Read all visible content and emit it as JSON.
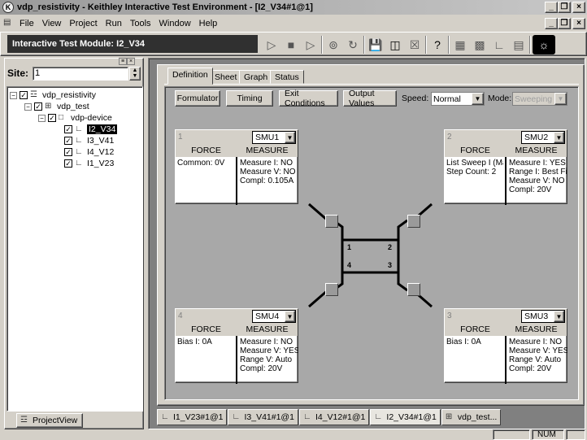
{
  "window": {
    "title": "vdp_resistivity - Keithley Interactive Test Environment - [I2_V34#1@1]",
    "doc_controls": [
      "_",
      "×"
    ],
    "window_controls": [
      "_",
      "❐",
      "×"
    ]
  },
  "menu": [
    "File",
    "View",
    "Project",
    "Run",
    "Tools",
    "Window",
    "Help"
  ],
  "toolbar": {
    "module_title": "Interactive Test Module: I2_V34",
    "icons": [
      "run-icon",
      "stop-icon",
      "run-step-icon",
      "append-run-icon",
      "repeat-icon",
      "save-icon",
      "save-all-icon",
      "close-icon",
      "help-icon",
      "grid-icon",
      "device-icon",
      "itm-icon",
      "sheet-icon",
      "logo-icon"
    ]
  },
  "project_panel": {
    "site_label": "Site:",
    "site_value": "1",
    "tree": [
      {
        "label": "vdp_resistivity",
        "level": 0,
        "icon": "project-icon"
      },
      {
        "label": "vdp_test",
        "level": 1,
        "icon": "plan-icon"
      },
      {
        "label": "vdp-device",
        "level": 2,
        "icon": "device-icon"
      },
      {
        "label": "I2_V34",
        "level": 3,
        "icon": "itm-icon",
        "selected": true
      },
      {
        "label": "I3_V41",
        "level": 3,
        "icon": "itm-icon"
      },
      {
        "label": "I4_V12",
        "level": 3,
        "icon": "itm-icon"
      },
      {
        "label": "I1_V23",
        "level": 3,
        "icon": "itm-icon"
      }
    ],
    "bottom_tab": "ProjectView"
  },
  "tabs": [
    "Definition",
    "Sheet",
    "Graph",
    "Status"
  ],
  "definition": {
    "buttons": [
      "Formulator",
      "Timing",
      "Exit Conditions",
      "Output Values"
    ],
    "speed_label": "Speed:",
    "speed_value": "Normal",
    "mode_label": "Mode:",
    "mode_value": "Sweeping"
  },
  "smus": [
    {
      "number": "1",
      "instrument": "SMU1",
      "force_header": "FORCE",
      "measure_header": "MEASURE",
      "force": [
        "Common: 0V"
      ],
      "measure": [
        "Measure I: NO",
        "Measure V: NO",
        "Compl: 0.105A"
      ]
    },
    {
      "number": "2",
      "instrument": "SMU2",
      "force_header": "FORCE",
      "measure_header": "MEASURE",
      "force": [
        "List Sweep I (Mas",
        "Step Count: 2"
      ],
      "measure": [
        "Measure I: YES",
        "Range I: Best Fix",
        "Measure V: NO",
        "Compl: 20V"
      ]
    },
    {
      "number": "4",
      "instrument": "SMU4",
      "force_header": "FORCE",
      "measure_header": "MEASURE",
      "force": [
        "Bias I: 0A"
      ],
      "measure": [
        "Measure I: NO",
        "Measure V: YES",
        "Range V: Auto",
        "Compl: 20V"
      ]
    },
    {
      "number": "3",
      "instrument": "SMU3",
      "force_header": "FORCE",
      "measure_header": "MEASURE",
      "force": [
        "Bias I: 0A"
      ],
      "measure": [
        "Measure I: NO",
        "Measure V: YES",
        "Range V: Auto",
        "Compl: 20V"
      ]
    }
  ],
  "device_pins": [
    "1",
    "2",
    "4",
    "3"
  ],
  "doc_tabs": [
    {
      "label": "I1_V23#1@1",
      "active": false
    },
    {
      "label": "I3_V41#1@1",
      "active": false
    },
    {
      "label": "I4_V12#1@1",
      "active": false
    },
    {
      "label": "I2_V34#1@1",
      "active": true
    },
    {
      "label": "vdp_test...",
      "active": false
    }
  ],
  "status": {
    "num": "NUM"
  }
}
